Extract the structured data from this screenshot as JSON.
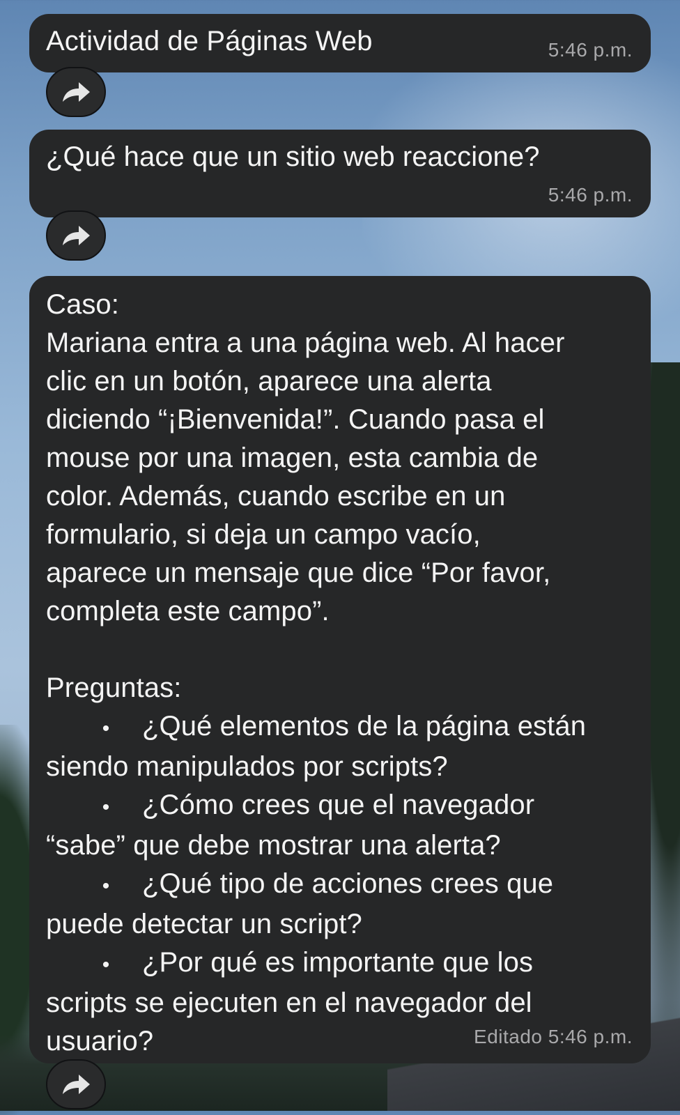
{
  "messages": [
    {
      "text": "Actividad de Páginas Web",
      "time": "5:46 p.m."
    },
    {
      "text": "¿Qué hace que un sitio web reaccione?",
      "time": "5:46 p.m."
    },
    {
      "case_heading": "Caso:",
      "case_lines": [
        "Mariana entra a una página web. Al hacer",
        "clic en un botón, aparece una alerta",
        "diciendo “¡Bienvenida!”. Cuando pasa el",
        "mouse por una imagen, esta cambia de",
        "color. Además, cuando escribe en un",
        "formulario, si deja un campo vacío,",
        "aparece un mensaje que dice “Por favor,",
        "completa este campo”."
      ],
      "questions_heading": "Preguntas:",
      "bullet_symbol": "•",
      "questions": [
        {
          "first": "¿Qué elementos de la página están",
          "rest": "siendo manipulados por scripts?"
        },
        {
          "first": "¿Cómo crees que el navegador",
          "rest": "“sabe” que debe mostrar una alerta?"
        },
        {
          "first": "¿Qué tipo de acciones crees que",
          "rest": "puede detectar un script?"
        },
        {
          "first": "¿Por qué es importante que los",
          "rest": "scripts se ejecuten en el navegador del"
        }
      ],
      "last_line": "usuario?",
      "time": "Editado 5:46 p.m."
    }
  ],
  "icons": {
    "forward": "forward-arrow-icon"
  },
  "colors": {
    "bubble": "#262728",
    "text": "#f4f4f4",
    "timestamp": "#a9a9ab"
  }
}
